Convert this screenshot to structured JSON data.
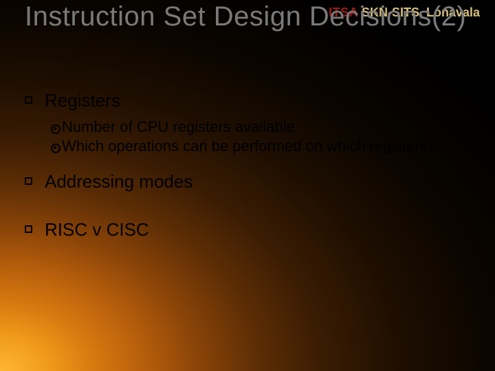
{
  "brand": {
    "part1": "ITSA ",
    "part2": "SKN-SITS, Lonavala"
  },
  "title": "Instruction Set Design Decisions(2)",
  "items": [
    {
      "label": "Registers",
      "sub": [
        "Number of CPU registers available",
        "Which operations can be performed on which registers?"
      ]
    },
    {
      "label": "Addressing modes",
      "sub": []
    },
    {
      "label": "RISC v CISC",
      "sub": []
    }
  ]
}
